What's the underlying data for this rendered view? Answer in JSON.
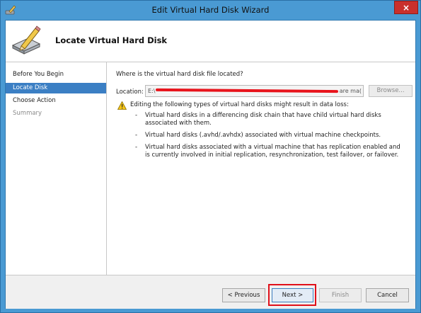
{
  "window": {
    "title": "Edit Virtual Hard Disk Wizard",
    "close_glyph": "×"
  },
  "header": {
    "title": "Locate Virtual Hard Disk",
    "icon": "disk-pencil-icon"
  },
  "nav": {
    "items": [
      {
        "label": "Before You Begin",
        "state": "normal"
      },
      {
        "label": "Locate Disk",
        "state": "selected"
      },
      {
        "label": "Choose Action",
        "state": "normal"
      },
      {
        "label": "Summary",
        "state": "disabled"
      }
    ]
  },
  "main": {
    "question": "Where is the virtual hard disk file located?",
    "location_label": "Location:",
    "location_value_start": "E:\\",
    "location_value_end": "are ma(",
    "browse_label": "Browse...",
    "warning_text": "Editing the following types of virtual hard disks might result in data loss:",
    "bullets": [
      "Virtual hard disks in a differencing disk chain that have child virtual hard disks associated with them.",
      "Virtual hard disks (.avhd/.avhdx) associated with virtual machine checkpoints.",
      "Virtual hard disks associated with a virtual machine that has replication enabled and is currently involved in initial replication, resynchronization, test failover, or failover."
    ]
  },
  "footer": {
    "previous_label": "< Previous",
    "next_label": "Next >",
    "finish_label": "Finish",
    "cancel_label": "Cancel"
  },
  "colors": {
    "title_bar": "#4a9ad3",
    "selected_nav": "#3b7fc4",
    "highlight": "#e0101a",
    "close_button": "#c9302c"
  }
}
